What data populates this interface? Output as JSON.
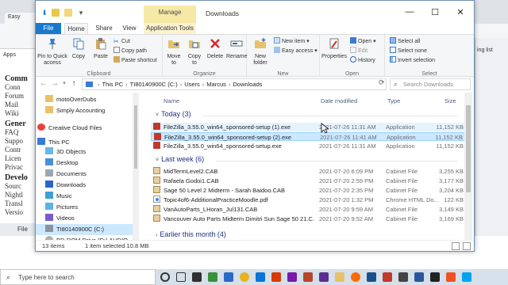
{
  "background_browser": {
    "tab_label": "Easy",
    "bookmark_label": "Apps",
    "sidebar": [
      {
        "kind": "h",
        "text": "Comm"
      },
      {
        "kind": "l",
        "text": "Conn"
      },
      {
        "kind": "l",
        "text": "Forum"
      },
      {
        "kind": "l",
        "text": "Mail"
      },
      {
        "kind": "l",
        "text": "Wiki"
      },
      {
        "kind": "h",
        "text": "Gener"
      },
      {
        "kind": "l",
        "text": "FAQ"
      },
      {
        "kind": "l",
        "text": "Suppo"
      },
      {
        "kind": "l",
        "text": "Contr"
      },
      {
        "kind": "l",
        "text": "Licen"
      },
      {
        "kind": "l",
        "text": "Privac"
      },
      {
        "kind": "h",
        "text": "Develo"
      },
      {
        "kind": "l",
        "text": "Sourc"
      },
      {
        "kind": "l",
        "text": "Nightl"
      },
      {
        "kind": "l",
        "text": "Transl"
      },
      {
        "kind": "l",
        "text": "Versio"
      }
    ],
    "right_label": "ing list",
    "status_text": "File"
  },
  "titlebar": {
    "manage_label": "Manage",
    "title": "Downloads",
    "minimize": "—",
    "maximize": "☐",
    "close": "✕"
  },
  "ribbon_tabs": {
    "file": "File",
    "home": "Home",
    "share": "Share",
    "view": "View",
    "app_tools": "Application Tools"
  },
  "ribbon": {
    "clipboard": {
      "pin_label": "Pin to Quick access",
      "copy_label": "Copy",
      "paste_label": "Paste",
      "cut_label": "Cut",
      "copy_path_label": "Copy path",
      "paste_shortcut_label": "Paste shortcut",
      "group_label": "Clipboard"
    },
    "organize": {
      "move_to_label": "Move to",
      "copy_to_label": "Copy to",
      "delete_label": "Delete",
      "rename_label": "Rename",
      "group_label": "Organize"
    },
    "new": {
      "new_folder_label": "New folder",
      "new_item_label": "New item",
      "easy_access_label": "Easy access",
      "group_label": "New"
    },
    "open": {
      "properties_label": "Properties",
      "open_label": "Open",
      "edit_label": "Edit",
      "history_label": "History",
      "group_label": "Open"
    },
    "select": {
      "select_all_label": "Select all",
      "select_none_label": "Select none",
      "invert_label": "Invert selection",
      "group_label": "Select"
    }
  },
  "address": {
    "breadcrumb": [
      "This PC",
      "TI80140900C (C:)",
      "Users",
      "Marcus",
      "Downloads"
    ],
    "search_placeholder": "Search Downloads"
  },
  "nav_pane": [
    {
      "label": "motoOverDubs",
      "icon": "folder"
    },
    {
      "label": "Simply Accounting",
      "icon": "folder"
    },
    {
      "label": "Creative Cloud Files",
      "icon": "cloud"
    },
    {
      "label": "This PC",
      "icon": "pc"
    },
    {
      "label": "3D Objects",
      "icon": "cube"
    },
    {
      "label": "Desktop",
      "icon": "desktop"
    },
    {
      "label": "Documents",
      "icon": "docs"
    },
    {
      "label": "Downloads",
      "icon": "download"
    },
    {
      "label": "Music",
      "icon": "music"
    },
    {
      "label": "Pictures",
      "icon": "pictures"
    },
    {
      "label": "Videos",
      "icon": "videos"
    },
    {
      "label": "TI80140900C (C:)",
      "icon": "drive"
    },
    {
      "label": "BD-ROM Drive (D:) AUDIO",
      "icon": "disc"
    }
  ],
  "columns": {
    "name": "Name",
    "date": "Date modified",
    "type": "Type",
    "size": "Size"
  },
  "groups": {
    "today": "Today (3)",
    "last_week": "Last week (6)",
    "earlier": "Earlier this month (4)"
  },
  "files_today": [
    {
      "name": "FileZilla_3.55.0_win64_sponsored-setup (1).exe",
      "date": "2021-07-26 11:31 AM",
      "type": "Application",
      "size": "11,152 KB",
      "icon": "exe"
    },
    {
      "name": "FileZilla_3.55.0_win64_sponsored-setup (2).exe",
      "date": "2021-07-26 11:41 AM",
      "type": "Application",
      "size": "11,152 KB",
      "icon": "exe"
    },
    {
      "name": "FileZilla_3.55.0_win64_sponsored-setup.exe",
      "date": "2021-07-26 11:31 AM",
      "type": "Application",
      "size": "11,152 KB",
      "icon": "exe"
    }
  ],
  "files_last_week": [
    {
      "name": "MidTermLevel2.CAB",
      "date": "2021-07-20 6:09 PM",
      "type": "Cabinet File",
      "size": "3,255 KB",
      "icon": "cab"
    },
    {
      "name": "Rafaela Godoi1.CAB",
      "date": "2021-07-20 2:59 PM",
      "type": "Cabinet File",
      "size": "3,177 KB",
      "icon": "cab"
    },
    {
      "name": "Sage 50 Level 2 Midterm - Sarah Baidoo.CAB",
      "date": "2021-07-20 2:35 PM",
      "type": "Cabinet File",
      "size": "3,204 KB",
      "icon": "cab"
    },
    {
      "name": "Topic4of6-AdditionalPracticeMoodle.pdf",
      "date": "2021-07-20 1:32 PM",
      "type": "Chrome HTML Do...",
      "size": "122 KB",
      "icon": "pdf"
    },
    {
      "name": "VanAutoParts_LHoran_Jul131.CAB",
      "date": "2021-07-20 9:59 AM",
      "type": "Cabinet File",
      "size": "3,149 KB",
      "icon": "cab"
    },
    {
      "name": "Vancouver Auto Parts Midterm Dimitri Sun Sage 50 21.C...",
      "date": "2021-07-20 9:52 AM",
      "type": "Cabinet File",
      "size": "3,169 KB",
      "icon": "cab"
    }
  ],
  "status": {
    "items": "13 items",
    "selected": "1 item selected  10.8 MB"
  },
  "taskbar": {
    "search_placeholder": "Type here to search"
  },
  "colors": {
    "accent": "#1979ca",
    "selection": "#cce8ff",
    "manage_tab": "#f6e9a6",
    "group_header": "#1e3287"
  }
}
